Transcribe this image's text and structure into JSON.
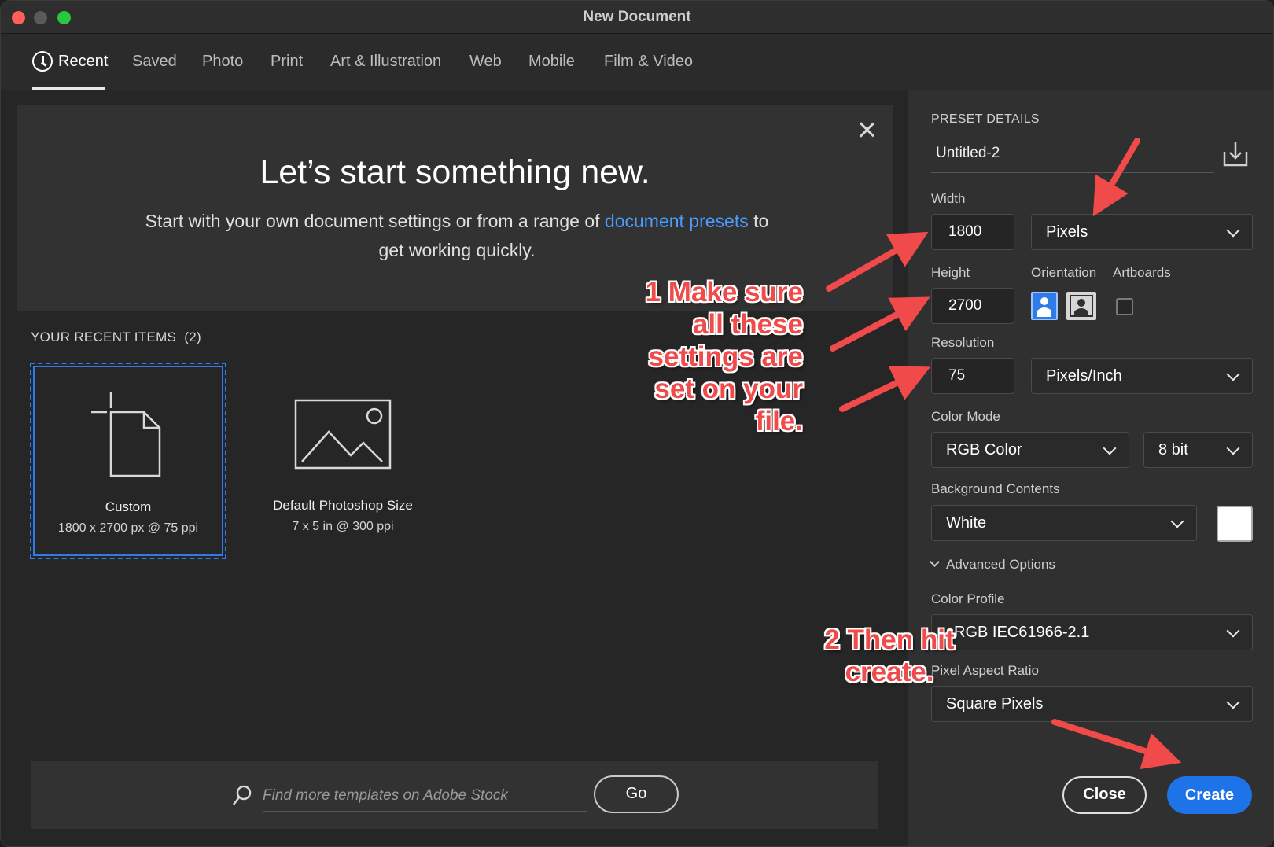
{
  "window": {
    "title": "New Document"
  },
  "tabs": [
    {
      "label": "Recent",
      "active": true,
      "icon": "clock-icon"
    },
    {
      "label": "Saved"
    },
    {
      "label": "Photo"
    },
    {
      "label": "Print"
    },
    {
      "label": "Art & Illustration"
    },
    {
      "label": "Web"
    },
    {
      "label": "Mobile"
    },
    {
      "label": "Film & Video"
    }
  ],
  "hero": {
    "title": "Let’s start something new.",
    "subtitle_before": "Start with your own document settings or from a range of ",
    "subtitle_link": "document presets",
    "subtitle_after": " to get working quickly."
  },
  "recent": {
    "heading": "YOUR RECENT ITEMS",
    "count": "(2)",
    "items": [
      {
        "name": "Custom",
        "meta": "1800 x 2700 px @ 75 ppi",
        "icon": "new-document-icon",
        "selected": true
      },
      {
        "name": "Default Photoshop Size",
        "meta": "7 x 5 in @ 300 ppi",
        "icon": "image-icon",
        "selected": false
      }
    ]
  },
  "search": {
    "placeholder": "Find more templates on Adobe Stock",
    "go_label": "Go"
  },
  "preset": {
    "heading": "PRESET DETAILS",
    "doc_name": "Untitled-2",
    "width_label": "Width",
    "width_value": "1800",
    "width_unit": "Pixels",
    "height_label": "Height",
    "height_value": "2700",
    "orientation_label": "Orientation",
    "orientation": "portrait",
    "artboards_label": "Artboards",
    "artboards_checked": false,
    "resolution_label": "Resolution",
    "resolution_value": "75",
    "resolution_unit": "Pixels/Inch",
    "color_mode_label": "Color Mode",
    "color_mode": "RGB Color",
    "bit_depth": "8 bit",
    "background_label": "Background Contents",
    "background": "White",
    "background_swatch": "#ffffff",
    "advanced_label": "Advanced Options",
    "color_profile_label": "Color Profile",
    "color_profile": "sRGB IEC61966-2.1",
    "pixel_aspect_label": "Pixel Aspect Ratio",
    "pixel_aspect": "Square Pixels"
  },
  "actions": {
    "close_label": "Close",
    "create_label": "Create"
  },
  "annotations": {
    "note1": "1 Make sure all these settings are set on your file.",
    "note2": "2 Then hit create."
  },
  "colors": {
    "accent": "#1f73e8",
    "annotation": "#f04a4a",
    "link": "#4b9cff"
  }
}
